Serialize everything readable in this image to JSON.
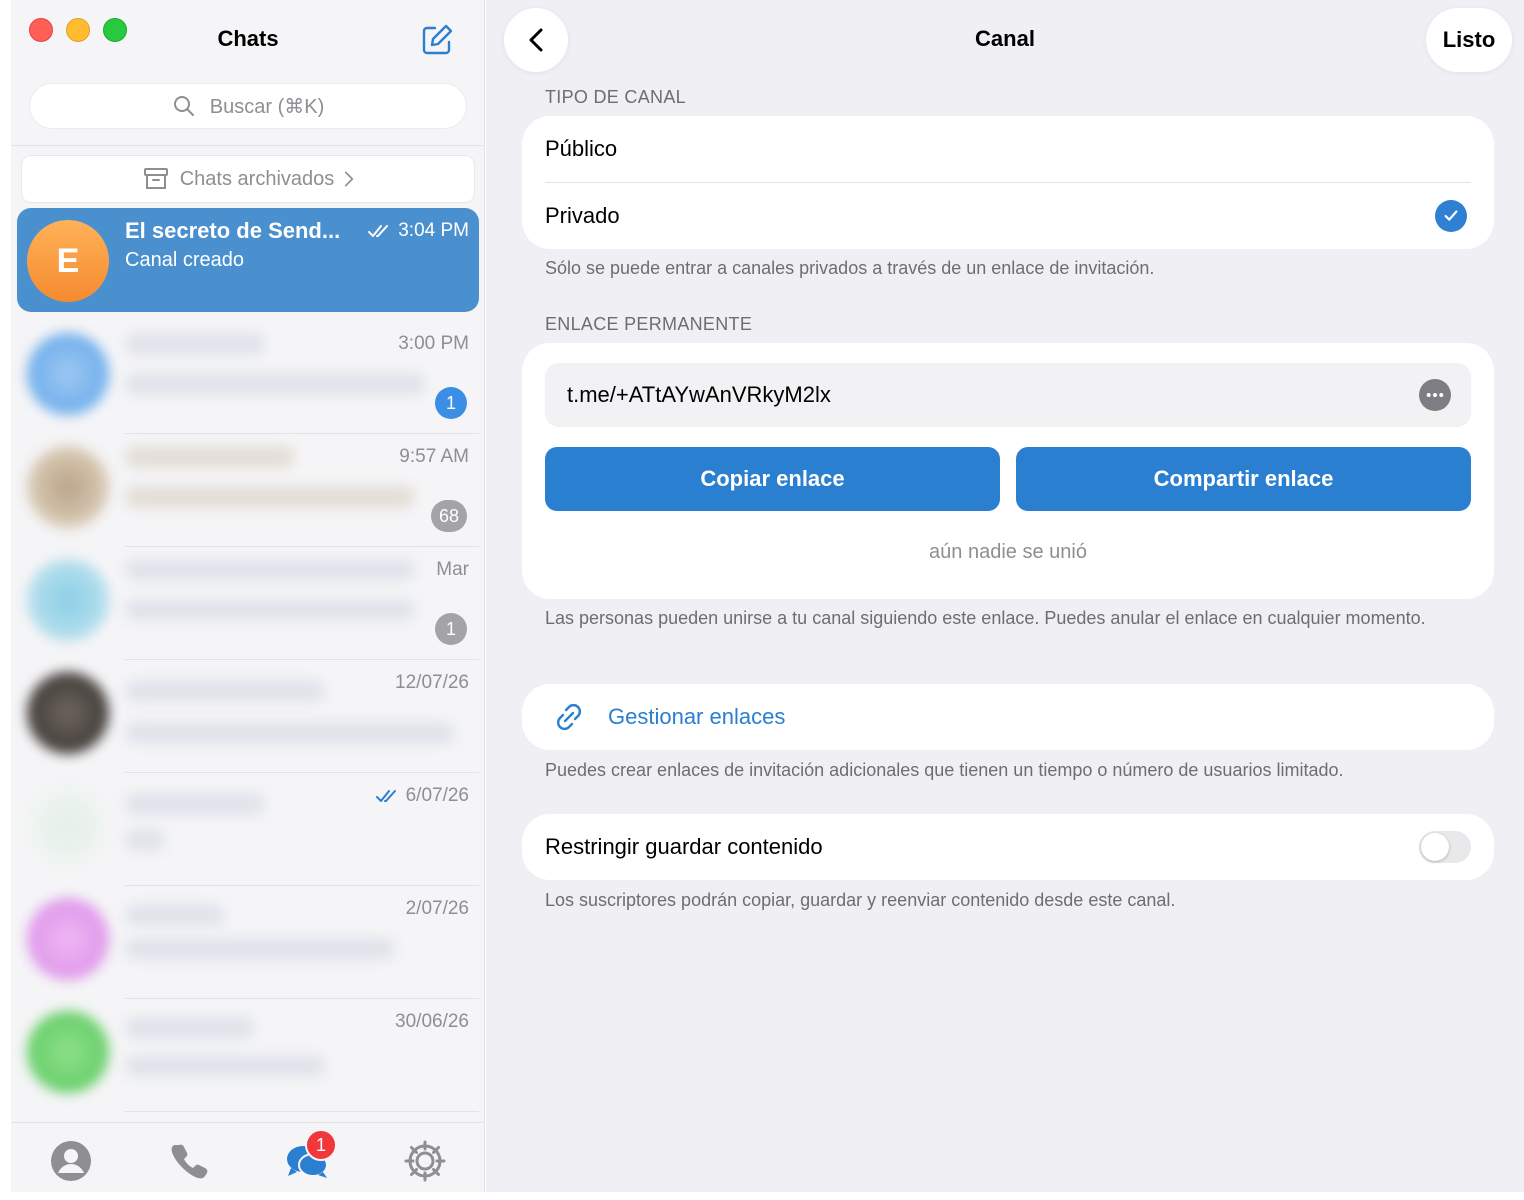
{
  "sidebar": {
    "title": "Chats",
    "search_placeholder": "Buscar (⌘K)",
    "archived_label": "Chats archivados",
    "chats": [
      {
        "avatar_letter": "E",
        "name": "El secreto de Send...",
        "preview": "Canal creado",
        "time": "3:04 PM",
        "read": true
      },
      {
        "time": "3:00 PM",
        "badge": "1"
      },
      {
        "time": "9:57 AM",
        "badge": "68"
      },
      {
        "time": "Mar",
        "badge": "1"
      },
      {
        "time": "12/07/26"
      },
      {
        "time": "6/07/26",
        "read": true
      },
      {
        "time": "2/07/26"
      },
      {
        "time": "30/06/26"
      }
    ],
    "tabbar_badge": "1"
  },
  "header": {
    "title": "Canal",
    "done_label": "Listo"
  },
  "channel_type": {
    "section_label": "TIPO DE CANAL",
    "option_public": "Público",
    "option_private": "Privado",
    "selected": "Privado",
    "footnote": "Sólo se puede entrar a canales privados a través de un enlace de invitación."
  },
  "permanent_link": {
    "section_label": "ENLACE PERMANENTE",
    "link": "t.me/+ATtAYwAnVRkyM2lx",
    "copy_label": "Copiar enlace",
    "share_label": "Compartir enlace",
    "joined_text": "aún nadie se unió",
    "footnote": "Las personas pueden unirse a tu canal siguiendo este enlace. Puedes anular el enlace en cualquier momento."
  },
  "manage_links": {
    "label": "Gestionar enlaces",
    "footnote": "Puedes crear enlaces de invitación adicionales que tienen un tiempo o número de usuarios limitado."
  },
  "restrict_content": {
    "label": "Restringir guardar contenido",
    "enabled": false,
    "footnote": "Los suscriptores podrán copiar, guardar y reenviar contenido desde este canal."
  },
  "colors": {
    "accent": "#2a7fd0",
    "active_chat": "#4a90cf",
    "badge_red": "#f2373a"
  }
}
